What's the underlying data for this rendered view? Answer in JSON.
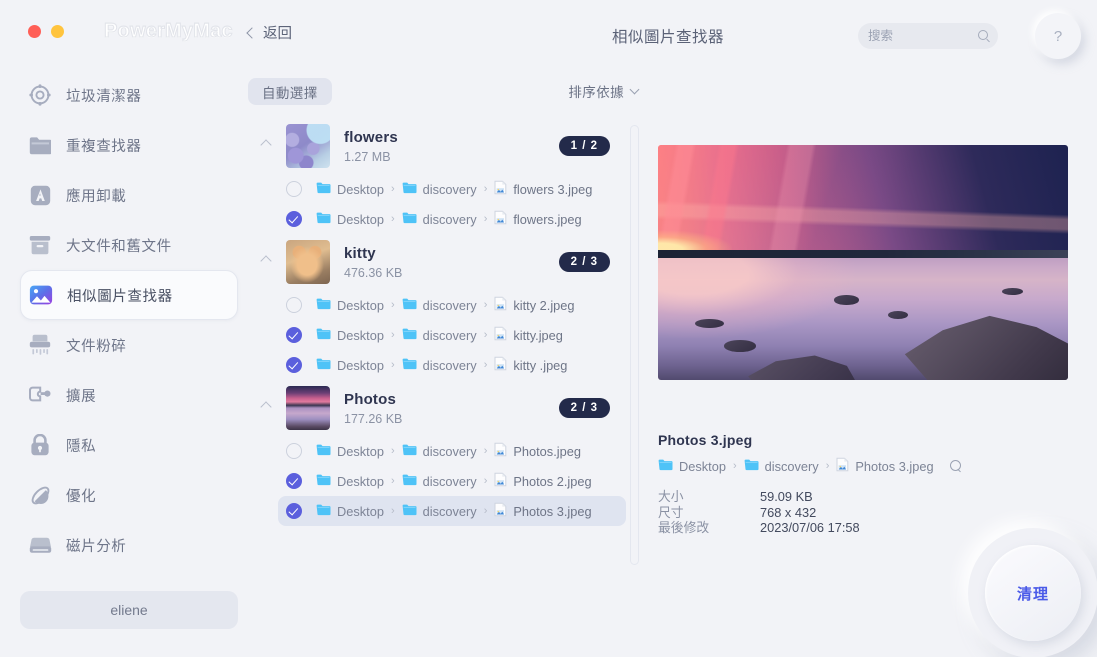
{
  "window": {
    "brand": "PowerMyMac",
    "back_label": "返回",
    "page_title": "相似圖片查找器",
    "help_label": "?"
  },
  "search": {
    "value": "",
    "placeholder": "搜索"
  },
  "sidebar": {
    "items": [
      {
        "label": "垃圾清潔器",
        "icon": "target-icon",
        "active": false
      },
      {
        "label": "重複查找器",
        "icon": "folder-icon",
        "active": false
      },
      {
        "label": "應用卸載",
        "icon": "app-uninstall-icon",
        "active": false
      },
      {
        "label": "大文件和舊文件",
        "icon": "archive-box-icon",
        "active": false
      },
      {
        "label": "相似圖片查找器",
        "icon": "photo-icon",
        "active": true
      },
      {
        "label": "文件粉碎",
        "icon": "shredder-icon",
        "active": false
      },
      {
        "label": "擴展",
        "icon": "extension-plug-icon",
        "active": false
      },
      {
        "label": "隱私",
        "icon": "lock-icon",
        "active": false
      },
      {
        "label": "優化",
        "icon": "optimize-icon",
        "active": false
      },
      {
        "label": "磁片分析",
        "icon": "disk-icon",
        "active": false
      }
    ],
    "user_button": "eliene"
  },
  "toolbar": {
    "auto_select": "自動選擇",
    "sort_by": "排序依據"
  },
  "groups": [
    {
      "name": "flowers",
      "size": "1.27 MB",
      "badge": "1 / 2",
      "thumb": "flowers",
      "files": [
        {
          "checked": false,
          "selected": false,
          "p1": "Desktop",
          "p2": "discovery",
          "file": "flowers 3.jpeg"
        },
        {
          "checked": true,
          "selected": false,
          "p1": "Desktop",
          "p2": "discovery",
          "file": "flowers.jpeg"
        }
      ]
    },
    {
      "name": "kitty",
      "size": "476.36 KB",
      "badge": "2 / 3",
      "thumb": "kitty",
      "files": [
        {
          "checked": false,
          "selected": false,
          "p1": "Desktop",
          "p2": "discovery",
          "file": "kitty 2.jpeg"
        },
        {
          "checked": true,
          "selected": false,
          "p1": "Desktop",
          "p2": "discovery",
          "file": "kitty.jpeg"
        },
        {
          "checked": true,
          "selected": false,
          "p1": "Desktop",
          "p2": "discovery",
          "file": "kitty .jpeg"
        }
      ]
    },
    {
      "name": "Photos",
      "size": "177.26 KB",
      "badge": "2 / 3",
      "thumb": "photos",
      "files": [
        {
          "checked": false,
          "selected": false,
          "p1": "Desktop",
          "p2": "discovery",
          "file": "Photos.jpeg"
        },
        {
          "checked": true,
          "selected": false,
          "p1": "Desktop",
          "p2": "discovery",
          "file": "Photos 2.jpeg"
        },
        {
          "checked": true,
          "selected": true,
          "p1": "Desktop",
          "p2": "discovery",
          "file": "Photos 3.jpeg"
        }
      ]
    }
  ],
  "detail": {
    "title": "Photos 3.jpeg",
    "path": {
      "p1": "Desktop",
      "p2": "discovery",
      "file": "Photos 3.jpeg"
    },
    "meta": [
      {
        "key": "大小",
        "value": "59.09 KB"
      },
      {
        "key": "尺寸",
        "value": "768 x 432"
      },
      {
        "key": "最後修改",
        "value": "2023/07/06 17:58"
      }
    ]
  },
  "clean_button": "清理",
  "colors": {
    "accent": "#5b5fdd",
    "badge_bg": "#232a4a",
    "folder": "#4ec3f7",
    "clean_text": "#4a5ae8",
    "background": "#f2f3f7"
  }
}
